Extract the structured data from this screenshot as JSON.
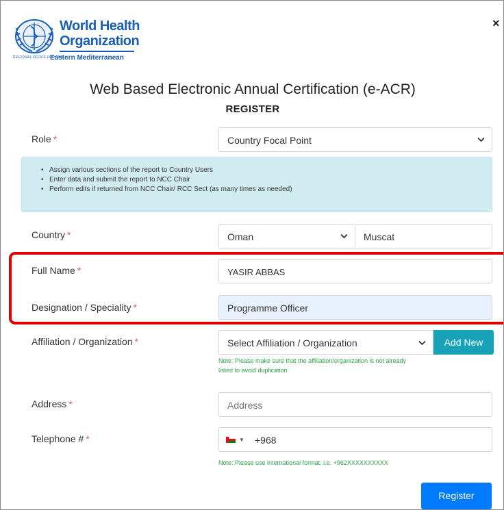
{
  "logo": {
    "line1": "World Health",
    "line2": "Organization",
    "small": "REGIONAL OFFICE FOR THE",
    "region": "Eastern Mediterranean"
  },
  "header": {
    "title": "Web Based Electronic Annual Certification (e-ACR)",
    "subtitle": "REGISTER",
    "close_label": "×"
  },
  "form": {
    "required_mark": "*",
    "role": {
      "label": "Role",
      "value": "Country Focal Point"
    },
    "info_items": [
      "Assign various sections of the report to Country Users",
      "Enter data and submit the report to NCC Chair",
      "Perform edits if returned from NCC Chair/ RCC Sect (as many times as needed)"
    ],
    "country": {
      "label": "Country",
      "value": "Oman",
      "city": "Muscat"
    },
    "full_name": {
      "label": "Full Name",
      "value": "YASIR ABBAS"
    },
    "designation": {
      "label": "Designation / Speciality",
      "value": "Programme Officer"
    },
    "affiliation": {
      "label": "Affiliation / Organization",
      "value": "Select Affiliation / Organization",
      "add_new_label": "Add New",
      "note_line1": "Note: Please make sure that the affiliation/organization is not already",
      "note_line2": "listed to avoid duplication"
    },
    "address": {
      "label": "Address",
      "placeholder": "Address"
    },
    "telephone": {
      "label": "Telephone #",
      "dial_code": "+968",
      "note": "Note: Please use international format. i.e. +962XXXXXXXXXX"
    },
    "register_label": "Register"
  },
  "colors": {
    "primary": "#007bff",
    "info_button": "#17a2b8",
    "info_bg": "#d1ecf1",
    "highlight": "#e00000",
    "note_green": "#28a745",
    "who_blue": "#1a5fb4",
    "filled_input_bg": "#e8f0fe"
  }
}
